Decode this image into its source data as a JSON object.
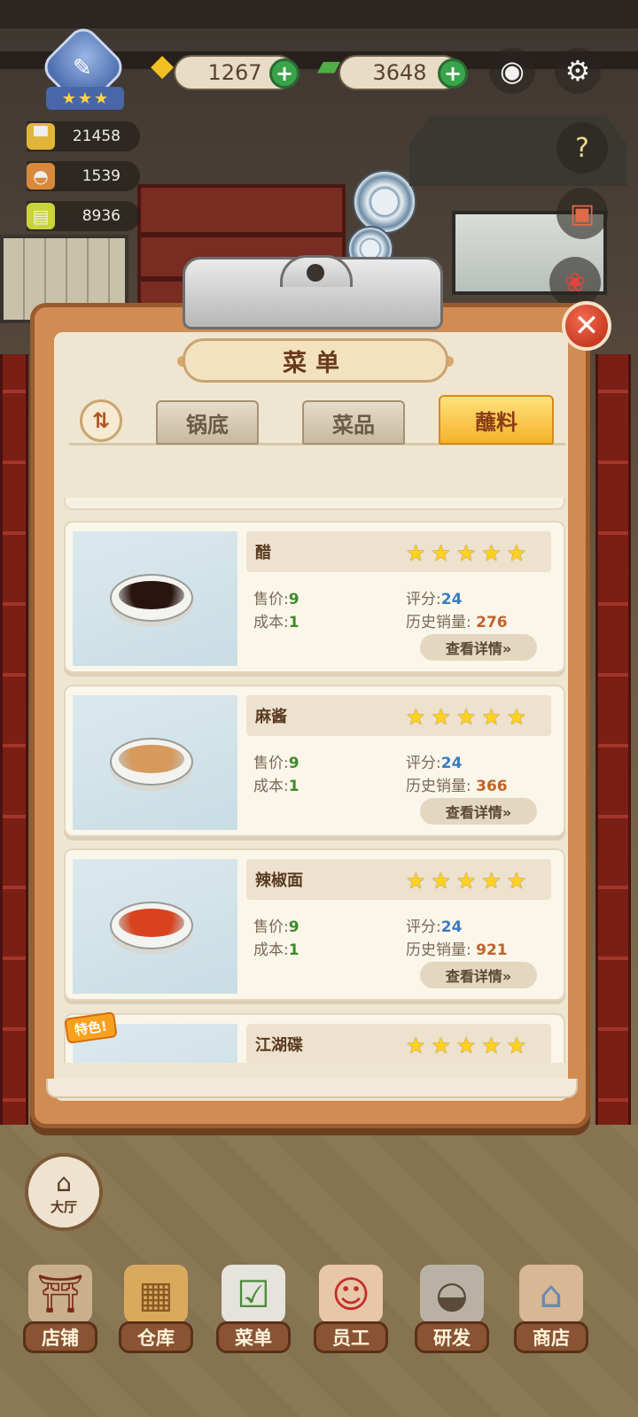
{
  "hud": {
    "gems": "1267",
    "cash": "3648",
    "stats": [
      "21458",
      "1539",
      "8936"
    ]
  },
  "panel": {
    "title": "菜单",
    "tabs": [
      "锅底",
      "菜品",
      "蘸料"
    ],
    "active_tab": 2
  },
  "labels": {
    "price": "售价",
    "cost": "成本",
    "score": "评分",
    "history_sales": "历史销量",
    "detail_button": "查看详情»",
    "special": "特色!"
  },
  "items": [
    {
      "name": "醋",
      "price": "9",
      "cost": "1",
      "score": "24",
      "sales": "276",
      "stars": 5,
      "color": "#2a1410"
    },
    {
      "name": "麻酱",
      "price": "9",
      "cost": "1",
      "score": "24",
      "sales": "366",
      "stars": 5,
      "color": "#d69a5c"
    },
    {
      "name": "辣椒面",
      "price": "9",
      "cost": "1",
      "score": "24",
      "sales": "921",
      "stars": 5,
      "color": "#d8421e"
    },
    {
      "name": "江湖碟",
      "stars": 5
    }
  ],
  "hall_button": "大厅",
  "nav": [
    "店铺",
    "仓库",
    "菜单",
    "员工",
    "研发",
    "商店"
  ],
  "colors": {
    "accent_tab": "#f5b22a",
    "close": "#c83c24",
    "nav_label": "#8a5434"
  }
}
